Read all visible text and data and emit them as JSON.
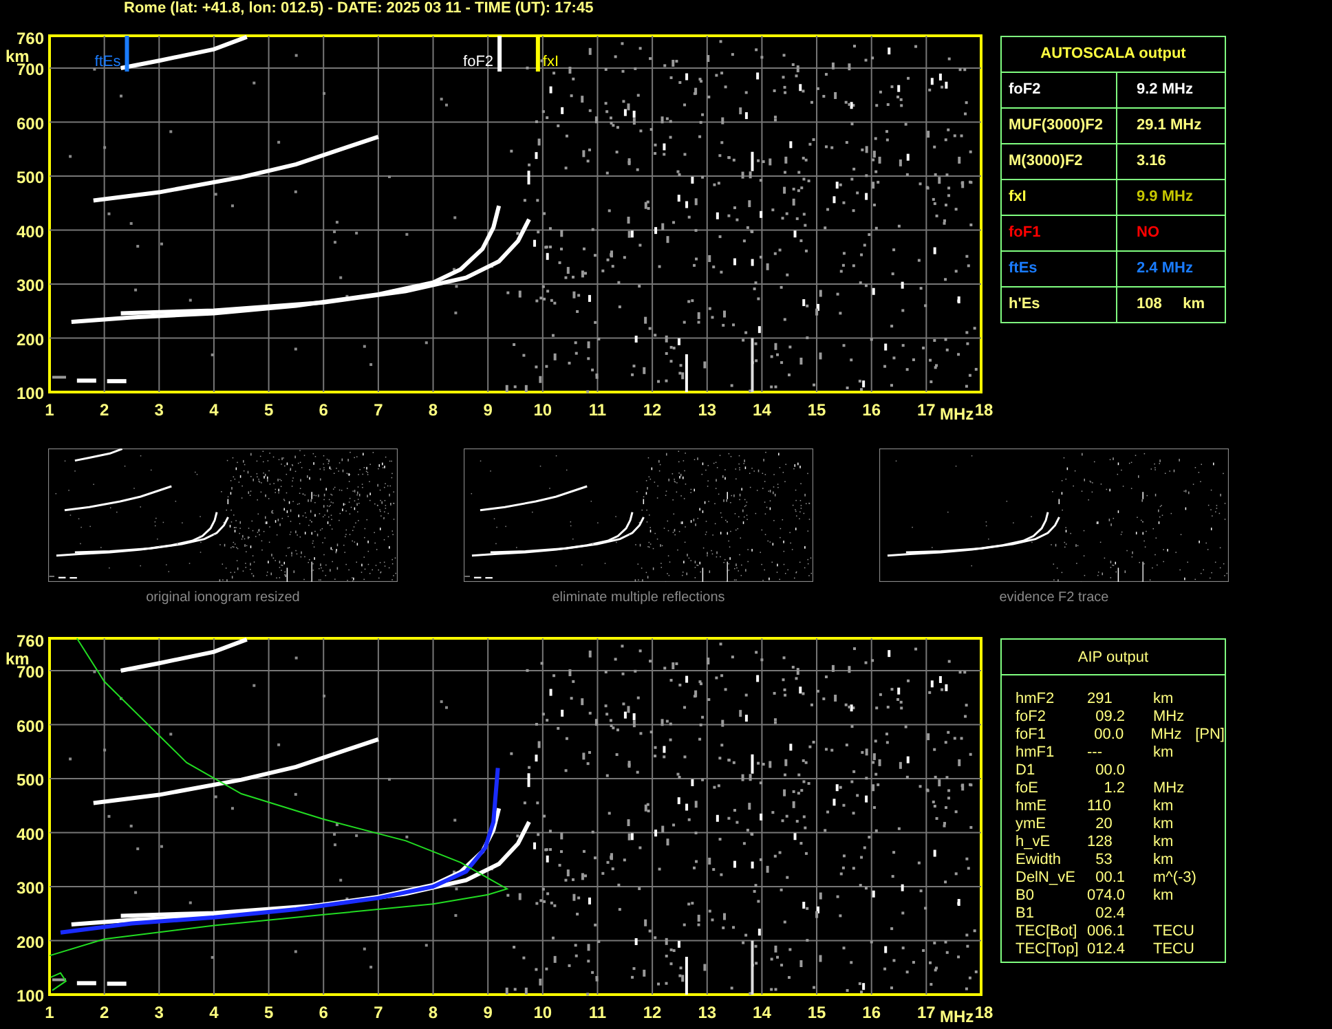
{
  "title": "Rome (lat: +41.8, lon: 012.5) - DATE: 2025 03 11 - TIME (UT): 17:45",
  "top_plot": {
    "y_ticks": [
      "760",
      "700",
      "600",
      "500",
      "400",
      "300",
      "200",
      "100"
    ],
    "y_unit": "km",
    "x_ticks": [
      "1",
      "2",
      "3",
      "4",
      "5",
      "6",
      "7",
      "8",
      "9",
      "10",
      "11",
      "12",
      "13",
      "14",
      "15",
      "16",
      "17",
      "18"
    ],
    "x_unit": "MHz",
    "markers": [
      {
        "label": "ftEs",
        "color": "#1a7cff"
      },
      {
        "label": "foF2",
        "color": "#ffffff"
      },
      {
        "label": "fxI",
        "color": "#ffff00"
      }
    ]
  },
  "autoscala": {
    "title": "AUTOSCALA output",
    "rows": [
      {
        "name": "foF2",
        "value": "9.2 MHz",
        "kind": "critical"
      },
      {
        "name": "MUF(3000)F2",
        "value": "29.1 MHz",
        "kind": "derived"
      },
      {
        "name": "M(3000)F2",
        "value": "3.16",
        "kind": "derived"
      },
      {
        "name": "fxI",
        "value": "9.9 MHz",
        "kind": "extraordinary"
      },
      {
        "name": "foF1",
        "value": "NO",
        "kind": "absent"
      },
      {
        "name": "ftEs",
        "value": "2.4 MHz",
        "kind": "sporadic"
      },
      {
        "name": "h'Es",
        "value": "108     km",
        "kind": "derived"
      }
    ]
  },
  "thumbnails": [
    {
      "kind": "full",
      "caption": "original ionogram resized"
    },
    {
      "kind": "no_multiples",
      "caption": "eliminate multiple reflections"
    },
    {
      "kind": "f2_only",
      "caption": "evidence F2 trace"
    }
  ],
  "bottom_plot": {
    "y_ticks": [
      "760",
      "700",
      "600",
      "500",
      "400",
      "300",
      "200",
      "100"
    ],
    "y_unit": "km",
    "x_ticks": [
      "1",
      "2",
      "3",
      "4",
      "5",
      "6",
      "7",
      "8",
      "9",
      "10",
      "11",
      "12",
      "13",
      "14",
      "15",
      "16",
      "17",
      "18"
    ],
    "x_unit": "MHz"
  },
  "aip": {
    "title": "AIP output",
    "rows": [
      {
        "name": "hmF2",
        "value": "291",
        "unit": "km"
      },
      {
        "name": "foF2",
        "value": "  09.2",
        "unit": "MHz"
      },
      {
        "name": "foF1",
        "value": "  00.0",
        "unit": "MHz",
        "note": "[PN]"
      },
      {
        "name": "hmF1",
        "value": "---",
        "unit": "km"
      },
      {
        "name": "D1",
        "value": "  00.0"
      },
      {
        "name": "foE",
        "value": "    1.2",
        "unit": "MHz"
      },
      {
        "name": "hmE",
        "value": "110",
        "unit": "km"
      },
      {
        "name": "ymE",
        "value": "  20",
        "unit": "km"
      },
      {
        "name": "h_vE",
        "value": "128",
        "unit": "km"
      },
      {
        "name": "Ewidth",
        "value": "  53",
        "unit": "km"
      },
      {
        "name": "DelN_vE",
        "value": "  00.1",
        "unit": "m^(-3)"
      },
      {
        "name": "B0",
        "value": "074.0",
        "unit": "km"
      },
      {
        "name": "B1",
        "value": "  02.4"
      },
      {
        "name": "TEC[Bot]",
        "value": "006.1",
        "unit": "TECU"
      },
      {
        "name": "TEC[Top]",
        "value": "012.4",
        "unit": "TECU"
      }
    ]
  }
}
